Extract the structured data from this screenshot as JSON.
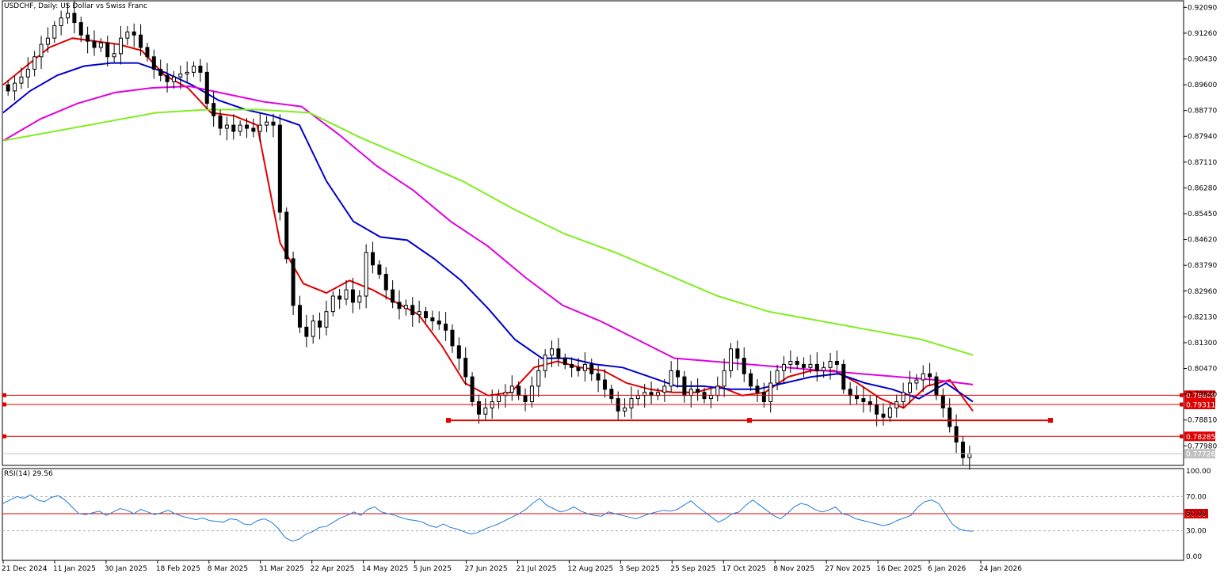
{
  "header": {
    "symbol": "USDCHF, Daily:",
    "description": "US Dollar vs Swiss Franc",
    "rsi_label": "RSI(14) 29.56"
  },
  "colors": {
    "candle": "#000000",
    "ma_fast": "#e00000",
    "ma_mid": "#0000cc",
    "ma_slow": "#e000e0",
    "ma_long": "#80ee20",
    "hline": "#e00000",
    "rsi": "#1f7bd8",
    "price_tag_bg": "#e00000",
    "current_tag_bg": "#c0c0c0"
  },
  "chart_data": {
    "type": "candlestick",
    "price_axis": {
      "ylim": [
        0.7735,
        0.922
      ],
      "ticks": [
        "0.92090",
        "0.91260",
        "0.90430",
        "0.89600",
        "0.88770",
        "0.87940",
        "0.87110",
        "0.86280",
        "0.85450",
        "0.84620",
        "0.83790",
        "0.82960",
        "0.82130",
        "0.81300",
        "0.80470",
        "0.79640",
        "0.78810",
        "0.77980"
      ]
    },
    "x_axis": {
      "labels": [
        "21 Dec 2024",
        "11 Jan 2025",
        "30 Jan 2025",
        "18 Feb 2025",
        "8 Mar 2025",
        "31 Mar 2025",
        "22 Apr 2025",
        "14 May 2025",
        "5 Jun 2025",
        "27 Jun 2025",
        "21 Jul 2025",
        "12 Aug 2025",
        "3 Sep 2025",
        "25 Sep 2025",
        "17 Oct 2025",
        "8 Nov 2025",
        "27 Nov 2025",
        "16 Dec 2025",
        "6 Jan 2026",
        "24 Jan 2026"
      ]
    },
    "closes": [
      0.894,
      0.8965,
      0.8985,
      0.901,
      0.905,
      0.909,
      0.911,
      0.915,
      0.9175,
      0.919,
      0.916,
      0.912,
      0.91,
      0.908,
      0.9095,
      0.905,
      0.906,
      0.911,
      0.913,
      0.912,
      0.908,
      0.905,
      0.901,
      0.899,
      0.897,
      0.8985,
      0.8995,
      0.9,
      0.902,
      0.9,
      0.89,
      0.886,
      0.882,
      0.883,
      0.881,
      0.883,
      0.882,
      0.881,
      0.883,
      0.884,
      0.883,
      0.855,
      0.84,
      0.825,
      0.818,
      0.815,
      0.82,
      0.818,
      0.823,
      0.828,
      0.827,
      0.83,
      0.826,
      0.828,
      0.842,
      0.838,
      0.835,
      0.83,
      0.826,
      0.824,
      0.825,
      0.822,
      0.823,
      0.821,
      0.82,
      0.819,
      0.817,
      0.812,
      0.808,
      0.802,
      0.794,
      0.79,
      0.792,
      0.794,
      0.796,
      0.797,
      0.799,
      0.796,
      0.794,
      0.799,
      0.804,
      0.809,
      0.811,
      0.808,
      0.806,
      0.805,
      0.804,
      0.806,
      0.803,
      0.801,
      0.798,
      0.795,
      0.791,
      0.792,
      0.795,
      0.796,
      0.797,
      0.796,
      0.797,
      0.799,
      0.804,
      0.802,
      0.796,
      0.798,
      0.797,
      0.795,
      0.796,
      0.799,
      0.804,
      0.811,
      0.808,
      0.803,
      0.799,
      0.797,
      0.794,
      0.8,
      0.804,
      0.806,
      0.807,
      0.806,
      0.805,
      0.806,
      0.804,
      0.805,
      0.807,
      0.806,
      0.798,
      0.796,
      0.795,
      0.794,
      0.793,
      0.79,
      0.789,
      0.792,
      0.794,
      0.797,
      0.8,
      0.801,
      0.803,
      0.802,
      0.796,
      0.792,
      0.786,
      0.781,
      0.776,
      0.7772
    ],
    "moving_averages": [
      {
        "color_key": "ma_fast",
        "points": [
          0.896,
          0.902,
          0.908,
          0.911,
          0.91,
          0.909,
          0.907,
          0.899,
          0.895,
          0.887,
          0.886,
          0.883,
          0.845,
          0.832,
          0.829,
          0.833,
          0.83,
          0.826,
          0.822,
          0.812,
          0.8,
          0.796,
          0.797,
          0.805,
          0.807,
          0.805,
          0.804,
          0.8,
          0.798,
          0.797,
          0.797,
          0.799,
          0.796,
          0.797,
          0.802,
          0.804,
          0.804,
          0.8,
          0.795,
          0.792,
          0.799,
          0.801,
          0.791
        ]
      },
      {
        "color_key": "ma_mid",
        "points": [
          0.887,
          0.894,
          0.899,
          0.902,
          0.903,
          0.903,
          0.9,
          0.896,
          0.891,
          0.888,
          0.886,
          0.883,
          0.865,
          0.852,
          0.847,
          0.846,
          0.84,
          0.833,
          0.824,
          0.814,
          0.808,
          0.808,
          0.806,
          0.805,
          0.802,
          0.799,
          0.799,
          0.798,
          0.798,
          0.8,
          0.802,
          0.803,
          0.8,
          0.798,
          0.795,
          0.8,
          0.794
        ]
      },
      {
        "color_key": "ma_slow",
        "points": [
          0.878,
          0.885,
          0.89,
          0.8935,
          0.895,
          0.8955,
          0.893,
          0.8905,
          0.889,
          0.88,
          0.87,
          0.862,
          0.852,
          0.844,
          0.834,
          0.825,
          0.82,
          0.814,
          0.808,
          0.807,
          0.806,
          0.805,
          0.804,
          0.803,
          0.802,
          0.801,
          0.7995
        ]
      },
      {
        "color_key": "ma_long",
        "points": [
          0.878,
          0.881,
          0.884,
          0.887,
          0.888,
          0.888,
          0.887,
          0.879,
          0.872,
          0.865,
          0.856,
          0.848,
          0.842,
          0.835,
          0.828,
          0.823,
          0.82,
          0.817,
          0.814,
          0.809
        ]
      }
    ],
    "horizontal_lines": [
      {
        "value": 0.79609,
        "label": "0.79609"
      },
      {
        "value": 0.79311,
        "label": "0.79311"
      },
      {
        "value": 0.78285,
        "label": "0.78285"
      }
    ],
    "support_segment": {
      "value": 0.788
    },
    "current_price": {
      "value": 0.77726,
      "label": "0.77726"
    },
    "rsi": {
      "ylim": [
        0,
        100
      ],
      "ticks": [
        "100.00",
        "70.00",
        "50.00",
        "30.00",
        "0.00"
      ],
      "level_label": "50.00",
      "level": 50,
      "values": [
        62,
        66,
        70,
        68,
        72,
        66,
        64,
        69,
        71,
        66,
        58,
        50,
        49,
        51,
        53,
        48,
        52,
        56,
        54,
        50,
        55,
        52,
        49,
        51,
        54,
        50,
        47,
        45,
        43,
        45,
        42,
        41,
        40,
        44,
        43,
        38,
        37,
        42,
        44,
        40,
        33,
        22,
        18,
        20,
        26,
        29,
        34,
        35,
        40,
        45,
        48,
        52,
        48,
        55,
        58,
        52,
        50,
        48,
        45,
        43,
        42,
        40,
        36,
        34,
        38,
        34,
        32,
        29,
        26,
        28,
        32,
        35,
        38,
        42,
        46,
        50,
        55,
        62,
        68,
        60,
        56,
        52,
        54,
        58,
        53,
        50,
        48,
        47,
        52,
        50,
        48,
        46,
        44,
        47,
        50,
        52,
        54,
        53,
        55,
        60,
        65,
        58,
        52,
        46,
        40,
        44,
        50,
        52,
        60,
        66,
        60,
        54,
        48,
        44,
        50,
        58,
        62,
        60,
        55,
        52,
        54,
        58,
        50,
        48,
        44,
        42,
        40,
        38,
        36,
        38,
        42,
        45,
        48,
        58,
        64,
        66,
        62,
        50,
        38,
        32,
        30,
        29.56
      ]
    }
  }
}
